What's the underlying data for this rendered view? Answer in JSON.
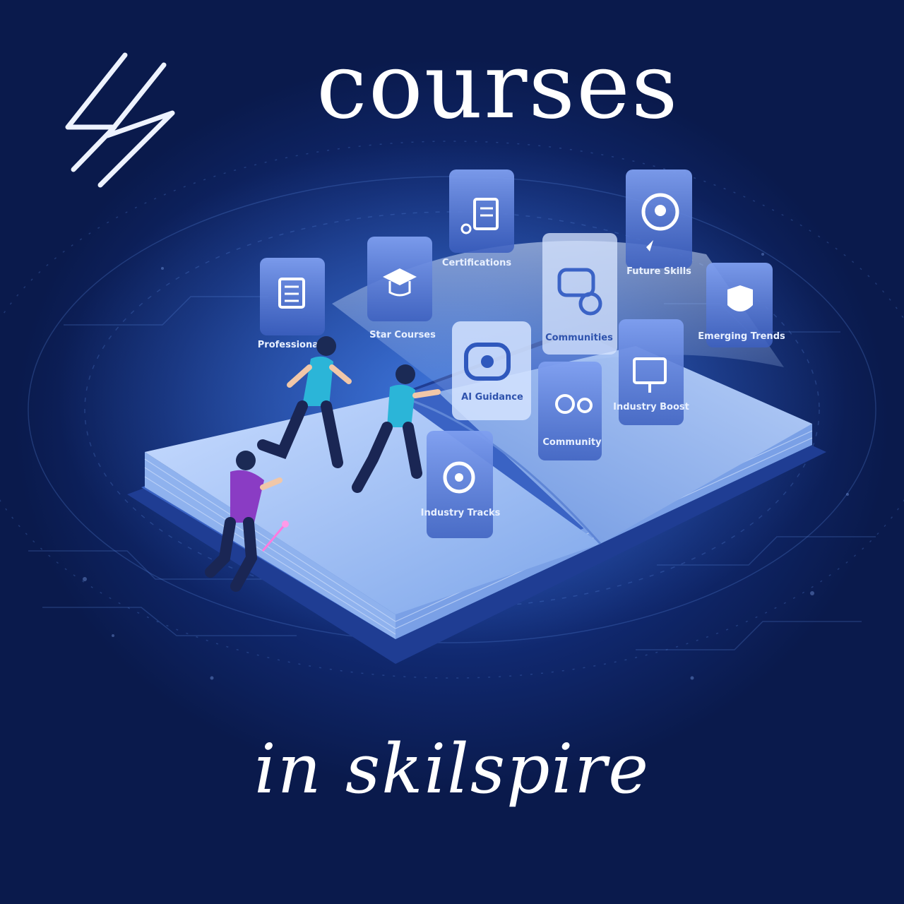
{
  "title": "courses",
  "subtitle": "in skilspire",
  "colors": {
    "background_dark": "#0a1a4c",
    "background_glow": "#2a5bc4",
    "text": "#ffffff",
    "book_page": "#9fc0f2",
    "card": "#5a7fd6",
    "runner_shirt_teal": "#2bb5d8",
    "runner_shirt_purple": "#8a3cc4"
  },
  "logo": {
    "icon": "double-lightning-bolt-icon"
  },
  "cards": [
    {
      "icon": "document-icon",
      "label": "Professionals"
    },
    {
      "icon": "graduation-cap-icon",
      "label": "Star Courses"
    },
    {
      "icon": "clipboard-user-icon",
      "label": "Certifications"
    },
    {
      "icon": "chat-bubbles-icon",
      "label": "Communities"
    },
    {
      "icon": "head-gears-icon",
      "label": "Future Skills"
    },
    {
      "icon": "shield-star-icon",
      "label": "Emerging Trends"
    },
    {
      "icon": "chat-face-icon",
      "label": "AI Guidance"
    },
    {
      "icon": "people-icon",
      "label": "Community"
    },
    {
      "icon": "monitor-people-icon",
      "label": "Industry Boost"
    },
    {
      "icon": "target-icon",
      "label": "Industry Tracks"
    }
  ]
}
